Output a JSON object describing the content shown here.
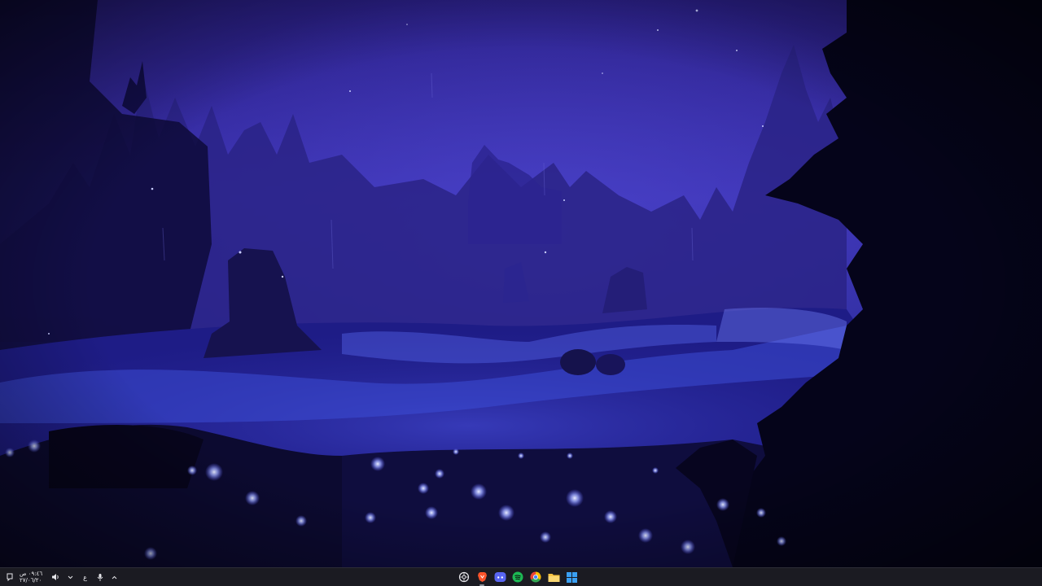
{
  "desktop": {
    "wallpaper": "night-forest-flower-field",
    "colors": {
      "sky": "#3a2fa8",
      "field": "#1b1a7a",
      "glow": "#8fa2ff",
      "silhouette": "#0a0720"
    }
  },
  "taskbar": {
    "background": "#1b1b22",
    "tray": {
      "clock_time": "٠٩:٤٦ ص",
      "clock_date": "٢٧/٠٦/٢٠",
      "language": "ع",
      "icons": [
        "notification-icon",
        "speaker-icon",
        "chevron-down-icon",
        "microphone-icon",
        "chevron-up-icon"
      ]
    },
    "apps": [
      {
        "name": "chatgpt",
        "icon": "chatgpt-icon"
      },
      {
        "name": "brave",
        "icon": "brave-icon",
        "color": "#fb542b"
      },
      {
        "name": "discord",
        "icon": "discord-icon",
        "color": "#5865f2"
      },
      {
        "name": "spotify",
        "icon": "spotify-icon",
        "color": "#1db954"
      },
      {
        "name": "chrome",
        "icon": "chrome-icon"
      },
      {
        "name": "file-explorer",
        "icon": "folder-icon",
        "color": "#f6c343"
      },
      {
        "name": "start",
        "icon": "windows-logo-icon",
        "color": "#3aa0f3"
      }
    ]
  }
}
